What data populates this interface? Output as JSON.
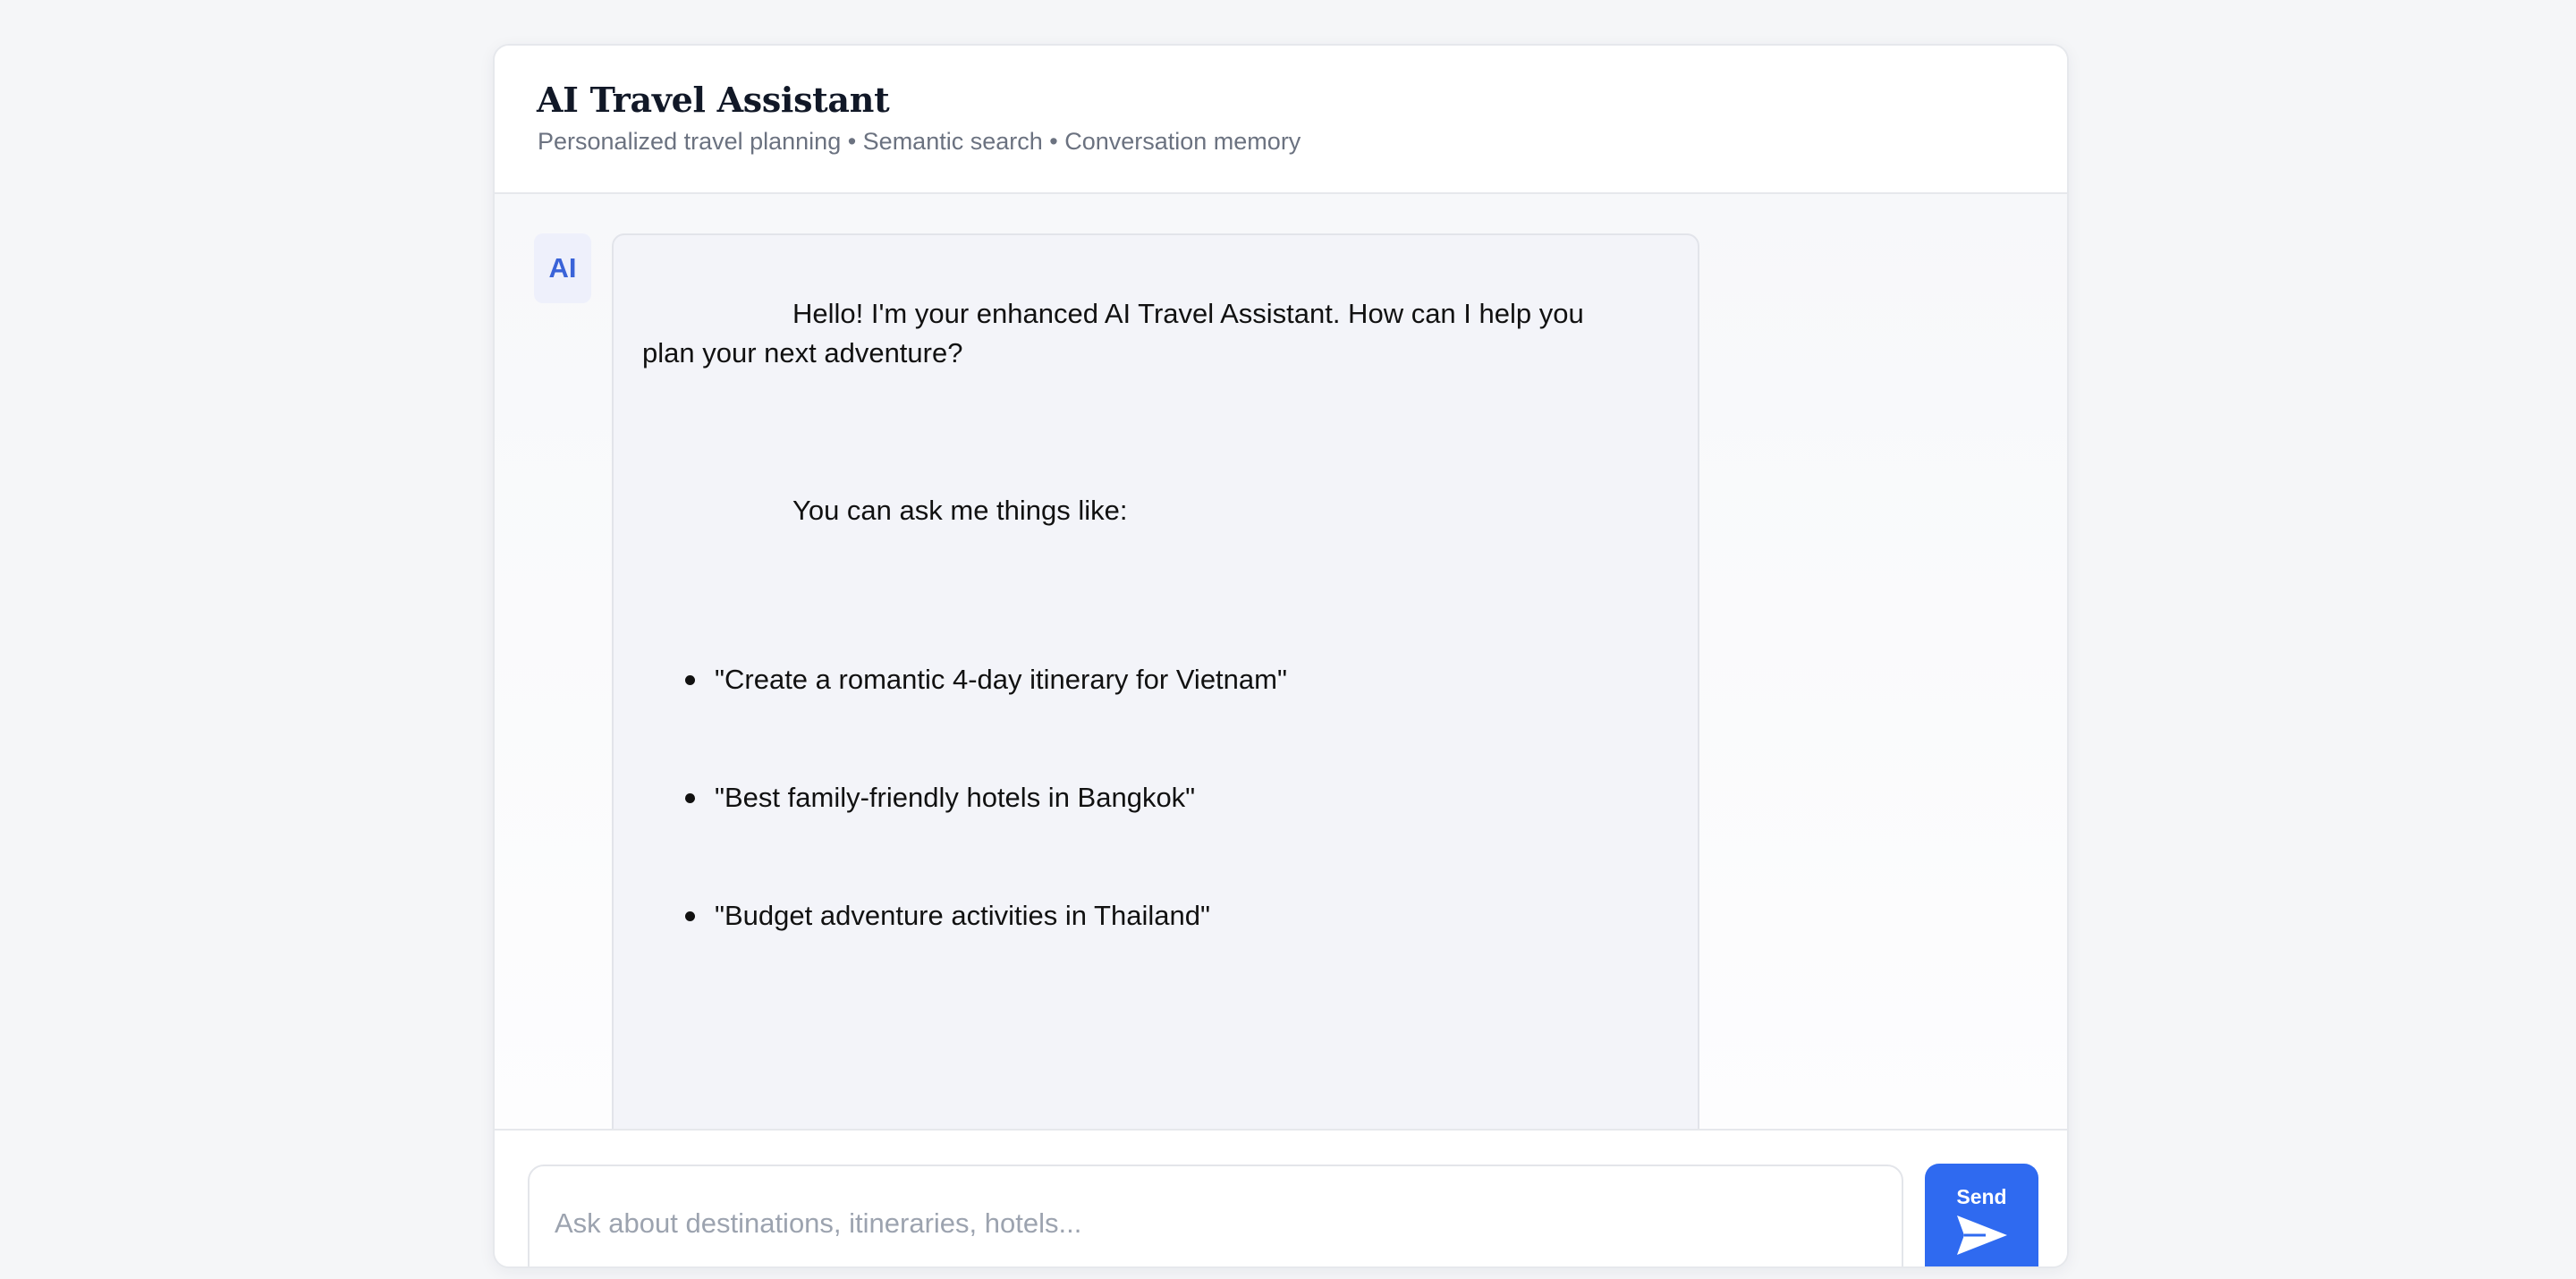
{
  "header": {
    "title": "AI Travel Assistant",
    "subtitle": "Personalized travel planning • Semantic search • Conversation memory"
  },
  "chat": {
    "assistant_avatar": "AI",
    "messages": [
      {
        "role": "assistant",
        "greeting_line1": "Hello! I'm your enhanced AI Travel Assistant. How can I help you",
        "greeting_line2": "plan your next adventure?",
        "intro": "You can ask me things like:",
        "examples": [
          "\"Create a romantic 4-day itinerary for Vietnam\"",
          "\"Best family-friendly hotels in Bangkok\"",
          "\"Budget adventure activities in Thailand\""
        ]
      }
    ]
  },
  "composer": {
    "placeholder": "Ask about destinations, itineraries, hotels...",
    "value": "",
    "send_label": "Send",
    "send_icon": "paper-plane-icon"
  },
  "colors": {
    "accent": "#2f6af0",
    "avatar_text": "#3a63d8",
    "bubble_bg": "#f3f4f9",
    "page_bg": "#f5f6f8"
  }
}
